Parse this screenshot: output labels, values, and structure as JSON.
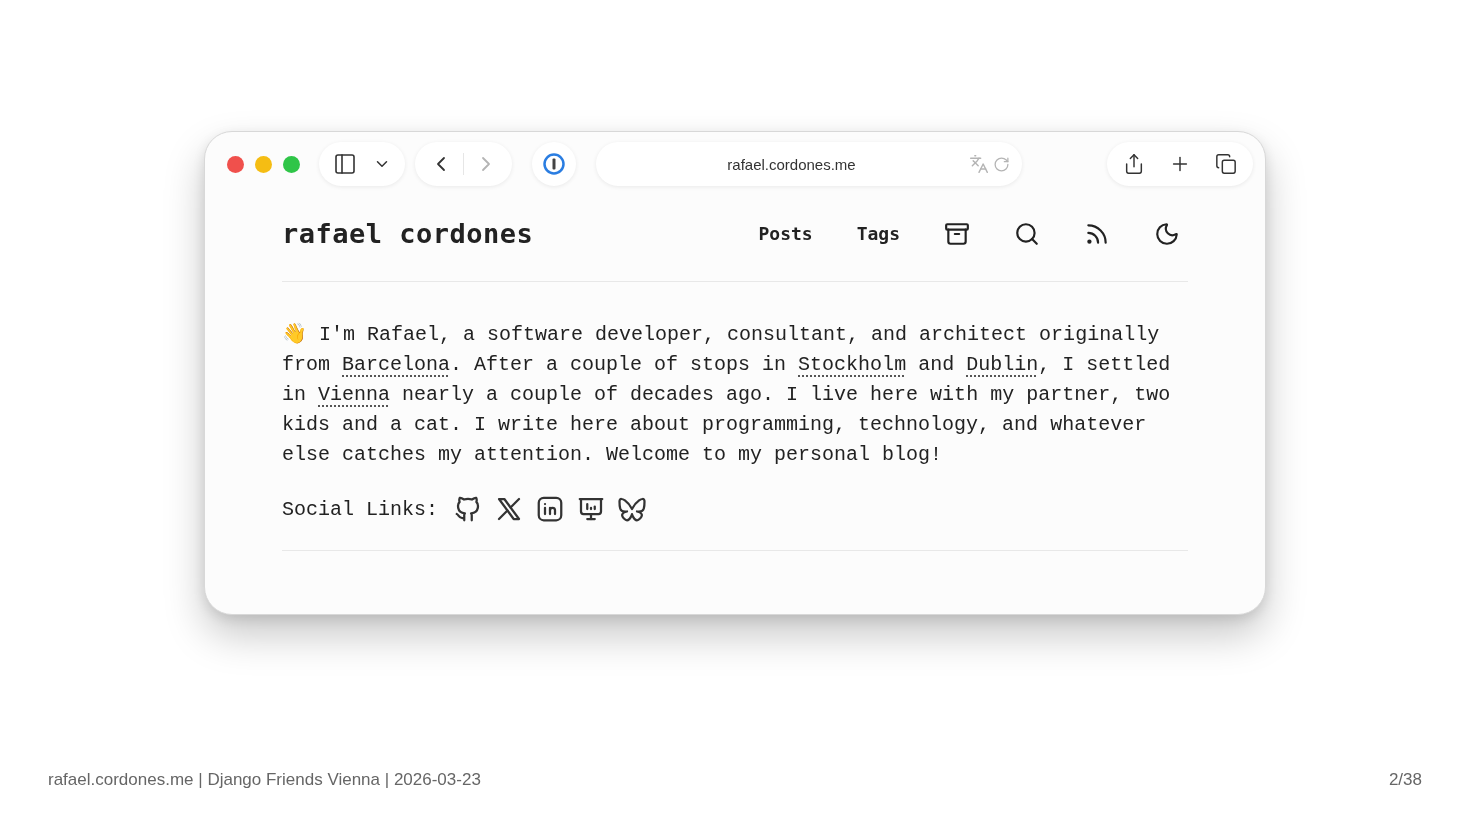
{
  "browser": {
    "back": {
      "disabled": false
    },
    "forward": {
      "disabled": true
    },
    "address": "rafael.cordones.me"
  },
  "site": {
    "title": "rafael cordones",
    "nav": [
      {
        "kind": "link",
        "label": "Posts"
      },
      {
        "kind": "link",
        "label": "Tags"
      },
      {
        "kind": "archive"
      },
      {
        "kind": "search"
      },
      {
        "kind": "rss"
      },
      {
        "kind": "theme"
      }
    ],
    "intro": [
      {
        "kind": "text",
        "text": "👋 I'm Rafael, a software developer, consultant, and architect originally from "
      },
      {
        "kind": "link",
        "text": "Barcelona"
      },
      {
        "kind": "text",
        "text": ". After a couple of stops in "
      },
      {
        "kind": "link",
        "text": "Stockholm"
      },
      {
        "kind": "text",
        "text": " and "
      },
      {
        "kind": "link",
        "text": "Dublin"
      },
      {
        "kind": "text",
        "text": ", I settled in "
      },
      {
        "kind": "link",
        "text": "Vienna"
      },
      {
        "kind": "text",
        "text": " nearly a couple of decades ago. I live here with my partner, two kids and a cat. I write here about programming, technology, and whatever else catches my attention. Welcome to my personal blog!"
      }
    ],
    "social_label": "Social Links:",
    "social": [
      {
        "kind": "github"
      },
      {
        "kind": "x"
      },
      {
        "kind": "linkedin"
      },
      {
        "kind": "slides"
      },
      {
        "kind": "bluesky"
      }
    ]
  },
  "footer": {
    "caption": "rafael.cordones.me | Django Friends Vienna | 2026-03-23",
    "page": "2/38"
  }
}
